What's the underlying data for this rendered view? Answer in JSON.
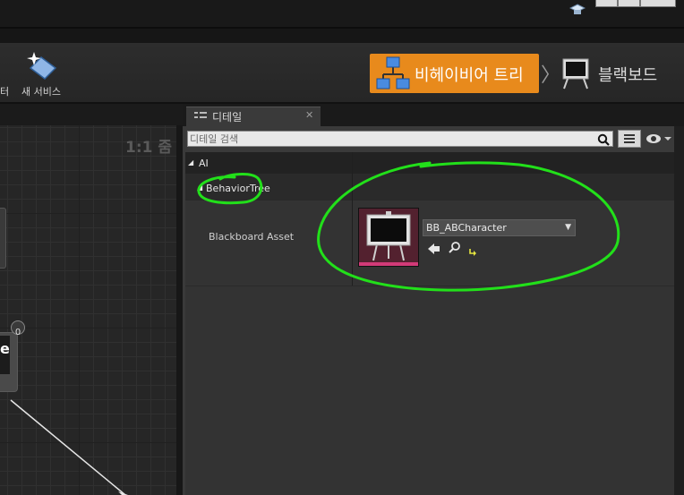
{
  "toolbar": {
    "partial_label": "터",
    "new_service_label": "새 서비스"
  },
  "modes": {
    "behavior_tree_label": "비헤이비어 트리",
    "blackboard_label": "블랙보드",
    "active_color": "#e88a1c"
  },
  "graph": {
    "zoom_label": "1:1 줌",
    "node_badge": "0",
    "node_partial_text": "e"
  },
  "details": {
    "tab_label": "디테일",
    "search_placeholder": "디테일 검색",
    "category_ai": "AI",
    "category_behavior_tree": "BehaviorTree",
    "property_label": "Blackboard Asset",
    "asset_value": "BB_ABCharacter"
  },
  "annotation": {
    "color": "#22e01a"
  },
  "icons": [
    "graduation-cap-icon",
    "minimize-icon",
    "maximize-icon",
    "close-icon",
    "new-service-icon",
    "behavior-tree-icon",
    "blackboard-icon",
    "details-icon",
    "search-icon",
    "grid-icon",
    "eye-icon",
    "browse-back-icon",
    "find-asset-icon",
    "use-selected-icon"
  ]
}
